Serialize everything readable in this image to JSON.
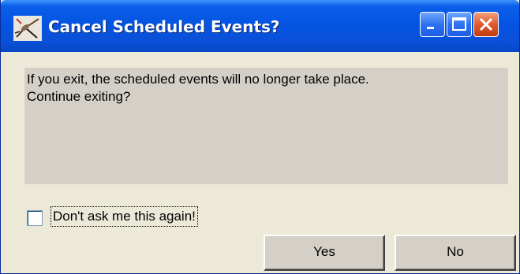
{
  "window": {
    "title": "Cancel Scheduled Events?",
    "app_icon": "mosquito-icon",
    "controls": {
      "minimize_icon": "minimize-icon",
      "maximize_icon": "maximize-icon",
      "close_icon": "close-icon"
    }
  },
  "dialog": {
    "message": "If you exit, the scheduled events will no longer take place.\nContinue exiting?",
    "dont_ask_checkbox": {
      "label": "Don't ask me this again!",
      "checked": false
    },
    "buttons": {
      "yes_label": "Yes",
      "no_label": "No"
    }
  },
  "colors": {
    "titlebar": "#0554e3",
    "dialog_bg": "#ece9d8",
    "message_panel": "#d4d0c8",
    "close_button": "#e05a2c"
  }
}
